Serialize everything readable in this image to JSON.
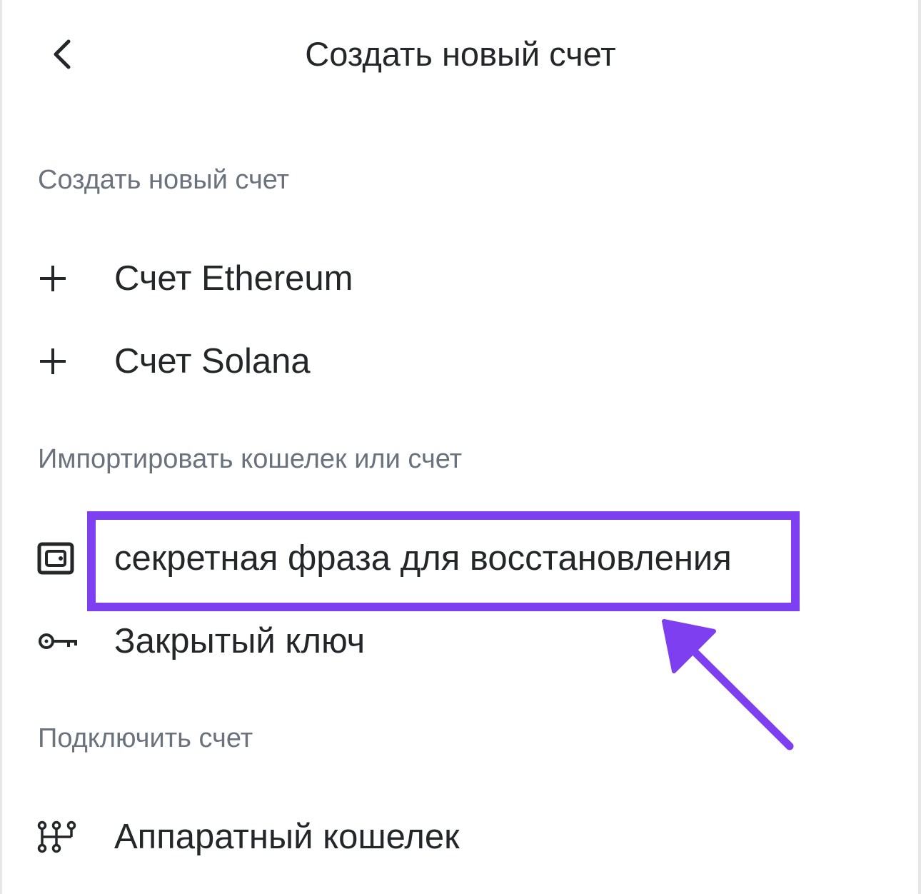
{
  "header": {
    "title": "Создать новый счет"
  },
  "sections": {
    "create": {
      "heading": "Создать новый счет",
      "items": [
        {
          "label": "Счет Ethereum",
          "icon": "plus-icon"
        },
        {
          "label": "Счет Solana",
          "icon": "plus-icon"
        }
      ]
    },
    "import": {
      "heading": "Импортировать кошелек или счет",
      "items": [
        {
          "label": "секретная фраза для восстановления",
          "icon": "wallet-icon"
        },
        {
          "label": "Закрытый ключ",
          "icon": "key-icon"
        }
      ]
    },
    "connect": {
      "heading": "Подключить счет",
      "items": [
        {
          "label": "Аппаратный кошелек",
          "icon": "hardware-wallet-icon"
        }
      ]
    }
  },
  "annotation": {
    "highlight_color": "#7d3ff0",
    "arrow_color": "#7d3ff0"
  },
  "colors": {
    "text_primary": "#24272a",
    "text_secondary": "#6a737d",
    "background": "#ffffff"
  }
}
